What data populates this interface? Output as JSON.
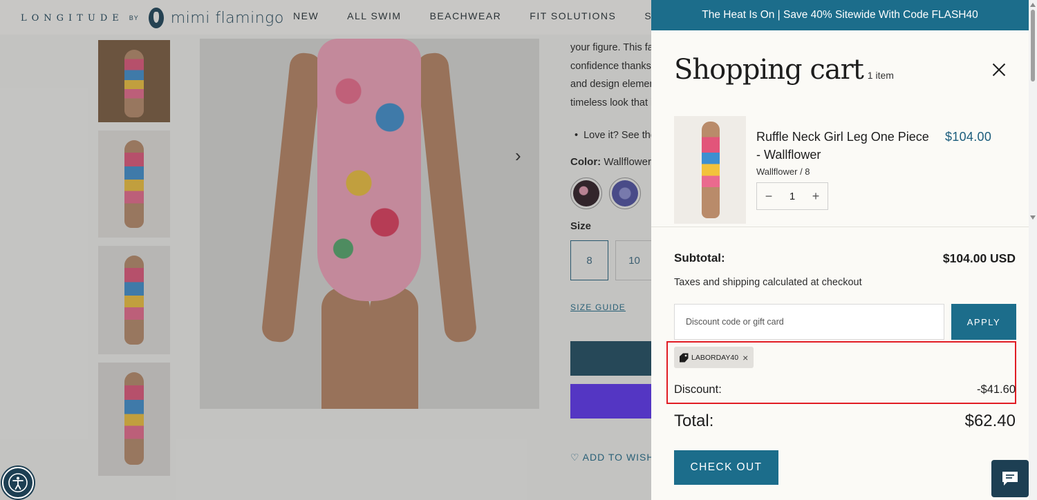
{
  "brand": {
    "name": "LONGITUDE",
    "by": "BY",
    "partner": "mimi flamingo"
  },
  "nav": {
    "items": [
      "NEW",
      "ALL SWIM",
      "BEACHWEAR",
      "FIT SOLUTIONS",
      "SALE"
    ]
  },
  "product": {
    "description_lines": [
      "your figure. This fa",
      "confidence thanks",
      "and design elemen",
      "timeless look that i"
    ],
    "bullet": "Love it? See the",
    "color_label": "Color:",
    "color_value": "Wallflower",
    "size_label": "Size",
    "sizes": [
      "8",
      "10"
    ],
    "size_guide": "SIZE GUIDE",
    "wishlist": "ADD TO WISH"
  },
  "cart": {
    "promo": "The Heat Is On | Save 40% Sitewide With Code FLASH40",
    "title": "Shopping cart",
    "count": "1 item",
    "item": {
      "name": "Ruffle Neck Girl Leg One Piece - Wallflower",
      "price": "$104.00",
      "variant": "Wallflower / 8",
      "quantity": "1"
    },
    "subtotal_label": "Subtotal:",
    "subtotal_value": "$104.00 USD",
    "tax_note": "Taxes and shipping calculated at checkout",
    "discount_placeholder": "Discount code or gift card",
    "apply_label": "APPLY",
    "applied_code": "LABORDAY40",
    "discount_label": "Discount:",
    "discount_value": "-$41.60",
    "total_label": "Total:",
    "total_value": "$62.40",
    "checkout_label": "CHECK OUT"
  },
  "colors": {
    "accent": "#1c6d8b",
    "dark": "#1d3f53",
    "price": "#1c5d7c",
    "highlight": "#e11c24"
  }
}
